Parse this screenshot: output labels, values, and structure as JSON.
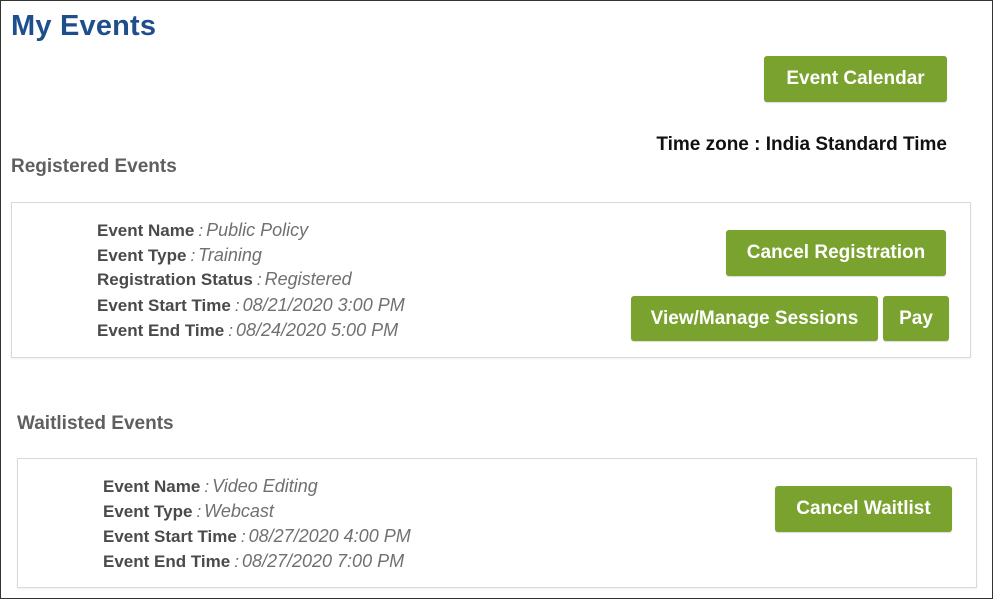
{
  "page": {
    "title": "My Events"
  },
  "header": {
    "event_calendar_label": "Event Calendar",
    "timezone_text": "Time zone : India Standard Time"
  },
  "registered": {
    "heading": "Registered Events",
    "fields": [
      {
        "label": "Event Name",
        "value": "Public Policy"
      },
      {
        "label": "Event Type",
        "value": "Training"
      },
      {
        "label": "Registration Status",
        "value": "Registered"
      },
      {
        "label": "Event Start Time",
        "value": "08/21/2020 3:00 PM"
      },
      {
        "label": "Event End Time",
        "value": "08/24/2020 5:00 PM"
      }
    ],
    "cancel_registration_label": "Cancel Registration",
    "view_manage_sessions_label": "View/Manage Sessions",
    "pay_label": "Pay"
  },
  "waitlisted": {
    "heading": "Waitlisted Events",
    "fields": [
      {
        "label": "Event Name",
        "value": "Video Editing"
      },
      {
        "label": "Event Type",
        "value": "Webcast"
      },
      {
        "label": "Event Start Time",
        "value": "08/27/2020 4:00 PM"
      },
      {
        "label": "Event End Time",
        "value": "08/27/2020 7:00 PM"
      }
    ],
    "cancel_waitlist_label": "Cancel Waitlist"
  },
  "colors": {
    "accent_green": "#79a22e",
    "title_blue": "#1f4e8c"
  }
}
